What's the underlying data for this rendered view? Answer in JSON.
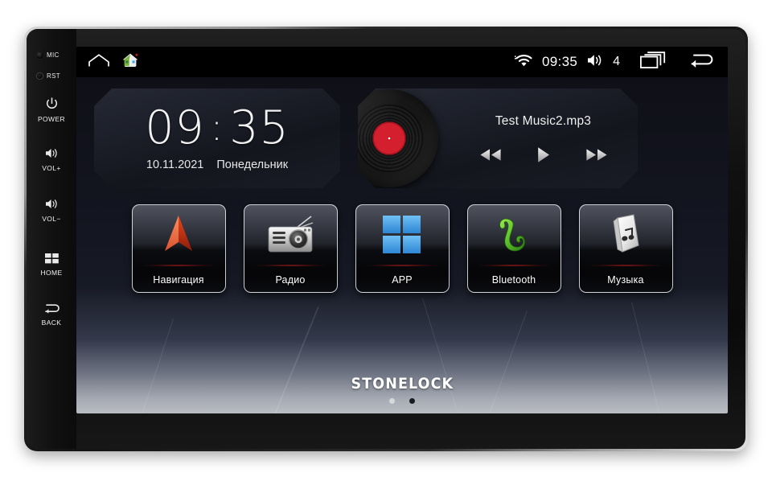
{
  "device": {
    "rail": {
      "indicators": [
        {
          "name": "mic",
          "label": "MIC"
        },
        {
          "name": "reset",
          "label": "RST"
        }
      ],
      "buttons": [
        {
          "name": "power",
          "label": "POWER",
          "icon": "power-icon"
        },
        {
          "name": "volume-up",
          "label": "VOL+",
          "icon": "speaker-icon"
        },
        {
          "name": "volume-down",
          "label": "VOL−",
          "icon": "speaker-icon"
        },
        {
          "name": "home",
          "label": "HOME",
          "icon": "grid-icon"
        },
        {
          "name": "back",
          "label": "BACK",
          "icon": "back-arrow-icon"
        }
      ]
    }
  },
  "statusbar": {
    "left_icons": [
      {
        "name": "home-outline-icon"
      },
      {
        "name": "house-app-icon"
      }
    ],
    "wifi_icon": "wifi-icon",
    "time": "09:35",
    "volume_icon": "volume-icon",
    "volume_level": "4",
    "recents_icon": "recents-icon",
    "back_icon": "back-arrow-icon"
  },
  "clock_widget": {
    "hours": "09",
    "colon": ":",
    "minutes": "35",
    "date": "10.11.2021",
    "weekday": "Понедельник"
  },
  "music_widget": {
    "album_art": "vinyl-record",
    "track_title": "Test Music2.mp3",
    "controls": [
      {
        "name": "previous-track-button",
        "icon": "rewind-icon"
      },
      {
        "name": "play-button",
        "icon": "play-icon"
      },
      {
        "name": "next-track-button",
        "icon": "fast-forward-icon"
      }
    ]
  },
  "dock": {
    "apps": [
      {
        "id": "navigation",
        "label": "Навигация",
        "icon": "navigation-arrow-icon"
      },
      {
        "id": "radio",
        "label": "Радио",
        "icon": "radio-icon"
      },
      {
        "id": "app",
        "label": "APP",
        "icon": "app-grid-icon"
      },
      {
        "id": "bluetooth",
        "label": "Bluetooth",
        "icon": "phone-handset-icon"
      },
      {
        "id": "music",
        "label": "Музыка",
        "icon": "mp3-player-icon"
      }
    ]
  },
  "brand": {
    "text": "STONELOCK",
    "page_dots": [
      {
        "state": "active"
      },
      {
        "state": "inactive"
      }
    ]
  },
  "colors": {
    "accent_red": "#d41f2e",
    "tile_glow": "#ff2828",
    "app_blue": "#4ea3e8",
    "bluetooth_green": "#5cc02c",
    "nav_orange": "#e8491f"
  }
}
